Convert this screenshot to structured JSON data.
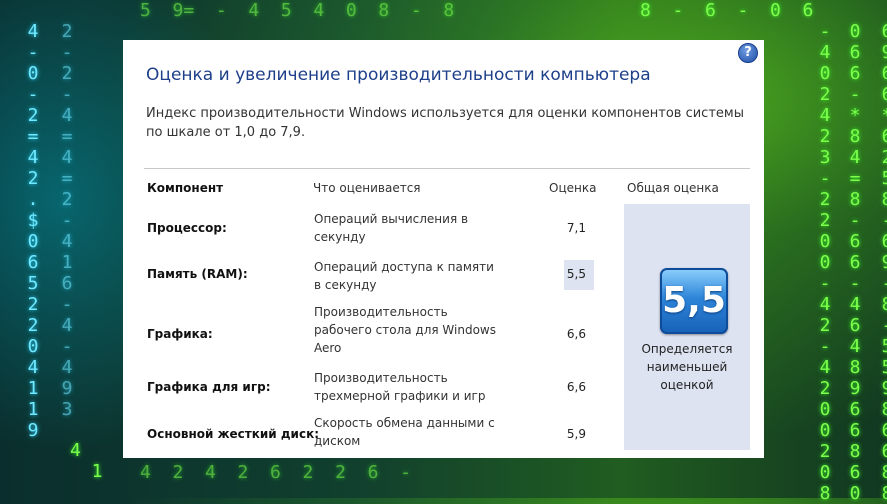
{
  "window": {
    "title": "Оценка и увеличение производительности компьютера",
    "description": "Индекс производительности Windows используется для оценки компонентов системы по шкале от 1,0 до 7,9.",
    "help_symbol": "?"
  },
  "table": {
    "headers": {
      "component": "Компонент",
      "what": "Что оценивается",
      "score": "Оценка",
      "overall": "Общая оценка"
    },
    "rows": [
      {
        "component": "Процессор:",
        "what": "Операций вычисления в секунду",
        "score": "7,1"
      },
      {
        "component": "Память (RAM):",
        "what": "Операций доступа к памяти в секунду",
        "score": "5,5"
      },
      {
        "component": "Графика:",
        "what": "Производительность рабочего стола для Windows Aero",
        "score": "6,6"
      },
      {
        "component": "Графика для игр:",
        "what": "Производительность трехмерной графики и игр",
        "score": "6,6"
      },
      {
        "component": "Основной жесткий диск:",
        "what": "Скорость обмена данными с диском",
        "score": "5,9"
      }
    ],
    "overall_score": "5,5",
    "overall_note": "Определяется наименьшей оценкой"
  },
  "colors": {
    "title": "#1e3f8a",
    "highlight": "#dde3f1",
    "badge": "#2e86d9"
  }
}
